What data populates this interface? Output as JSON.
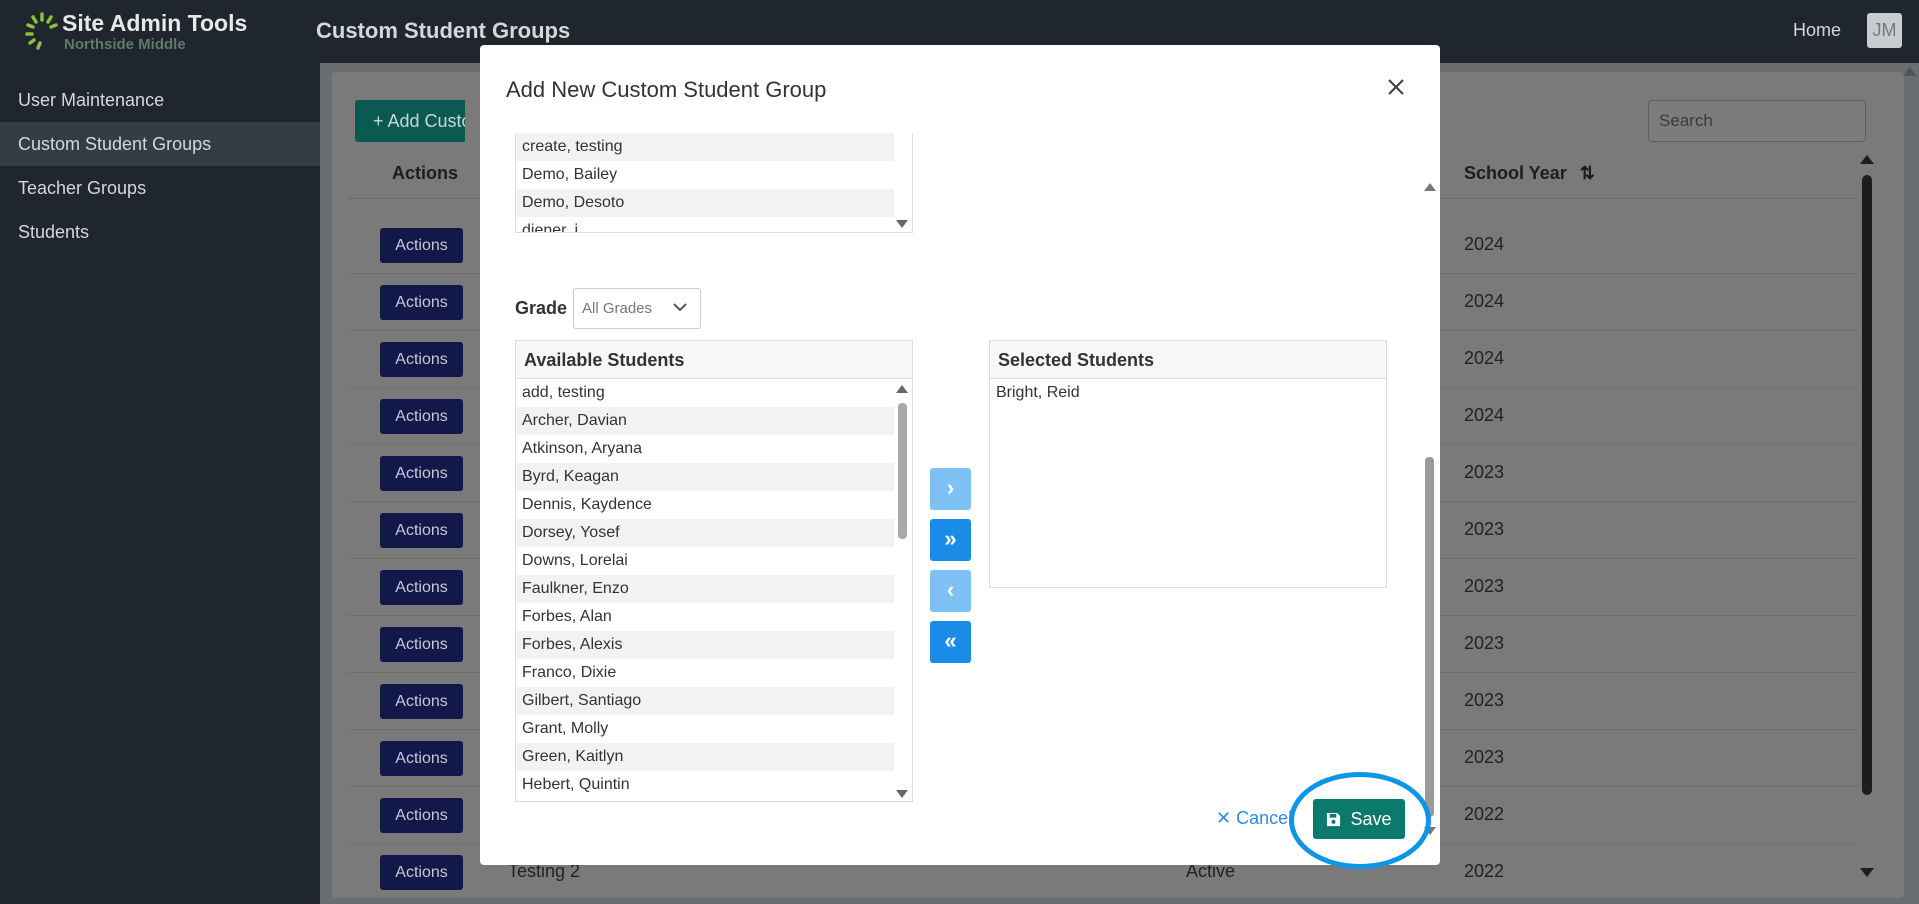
{
  "brand": {
    "title": "Site Admin Tools",
    "subtitle": "Northside Middle"
  },
  "sidebar": {
    "items": [
      {
        "label": "User Maintenance"
      },
      {
        "label": "Custom Student Groups",
        "active": true
      },
      {
        "label": "Teacher Groups"
      },
      {
        "label": "Students"
      }
    ]
  },
  "header": {
    "title": "Custom Student Groups",
    "home": "Home",
    "avatar": "JM"
  },
  "main": {
    "add_button": "+ Add Custom",
    "search_placeholder": "Search",
    "columns": {
      "actions": "Actions",
      "school_year": "School Year"
    },
    "row_button": "Actions",
    "rows": [
      {
        "year": "2024"
      },
      {
        "year": "2024"
      },
      {
        "year": "2024"
      },
      {
        "year": "2024"
      },
      {
        "year": "2023"
      },
      {
        "year": "2023"
      },
      {
        "year": "2023"
      },
      {
        "year": "2023"
      },
      {
        "year": "2023"
      },
      {
        "year": "2023"
      },
      {
        "year": "2022"
      },
      {
        "year": "2022",
        "name": "Testing 2",
        "status": "Active"
      }
    ]
  },
  "modal": {
    "title": "Add New Custom Student Group",
    "top_list": [
      "create, testing",
      "Demo, Bailey",
      "Demo, Desoto",
      "diener, j"
    ],
    "grade_label": "Grade",
    "grade_value": "All Grades",
    "available_header": "Available Students",
    "available": [
      "add, testing",
      "Archer, Davian",
      "Atkinson, Aryana",
      "Byrd, Keagan",
      "Dennis, Kaydence",
      "Dorsey, Yosef",
      "Downs, Lorelai",
      "Faulkner, Enzo",
      "Forbes, Alan",
      "Forbes, Alexis",
      "Franco, Dixie",
      "Gilbert, Santiago",
      "Grant, Molly",
      "Green, Kaitlyn",
      "Hebert, Quintin"
    ],
    "selected_header": "Selected Students",
    "selected": [
      "Bright, Reid"
    ],
    "transfer": {
      "move_one": "›",
      "move_all": "»",
      "remove_one": "‹",
      "remove_all": "«"
    },
    "cancel": "Cancel",
    "save": "Save"
  },
  "colors": {
    "sidebar_bg": "#1f262d",
    "save_green": "#0b7a6c",
    "row_action_navy": "#12184a",
    "highlight": "#0d96e6",
    "transfer_blue": "#1a8ce8"
  }
}
